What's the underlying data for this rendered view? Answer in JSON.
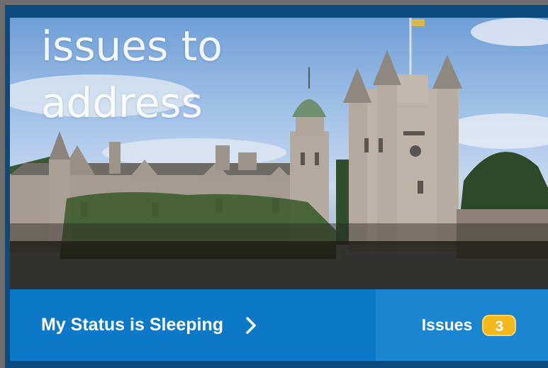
{
  "hero": {
    "headline_line1": "issues to",
    "headline_line2": "address",
    "image_description_icon": "castle-photo"
  },
  "status_button": {
    "label": "My Status is Sleeping",
    "icon": "chevron-right-icon"
  },
  "issues_button": {
    "label": "Issues",
    "count": "3"
  },
  "colors": {
    "frame": "#0b4a7a",
    "status_bar": "#0b78c8",
    "issues_bar": "#1a86d2",
    "badge": "#f2b81c"
  }
}
